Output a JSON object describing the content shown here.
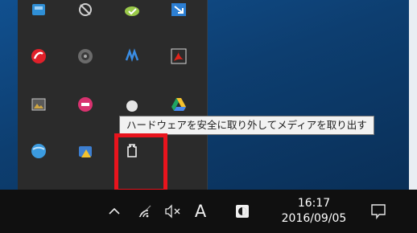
{
  "tooltip": {
    "text": "ハードウェアを安全に取り外してメディアを取り出す"
  },
  "taskbar": {
    "ime_mode": "A",
    "clock": {
      "time": "16:17",
      "date": "2016/09/05"
    }
  },
  "tray_icons": [
    "blue-app-icon",
    "satellite-dish-icon",
    "green-cloud-check-icon",
    "blue-arrow-icon",
    "trend-micro-icon",
    "speaker-round-icon",
    "blue-wave-icon",
    "adobe-acrobat-icon",
    "photo-icon",
    "pink-sync-icon",
    "white-gear-icon",
    "google-drive-icon",
    "blue-globe-icon",
    "warning-app-icon",
    "usb-eject-icon"
  ],
  "colors": {
    "annotation": "#e8141d",
    "taskbar": "#101010",
    "flyout": "#2b2b2b",
    "tooltip_bg": "#f2f2f2"
  }
}
